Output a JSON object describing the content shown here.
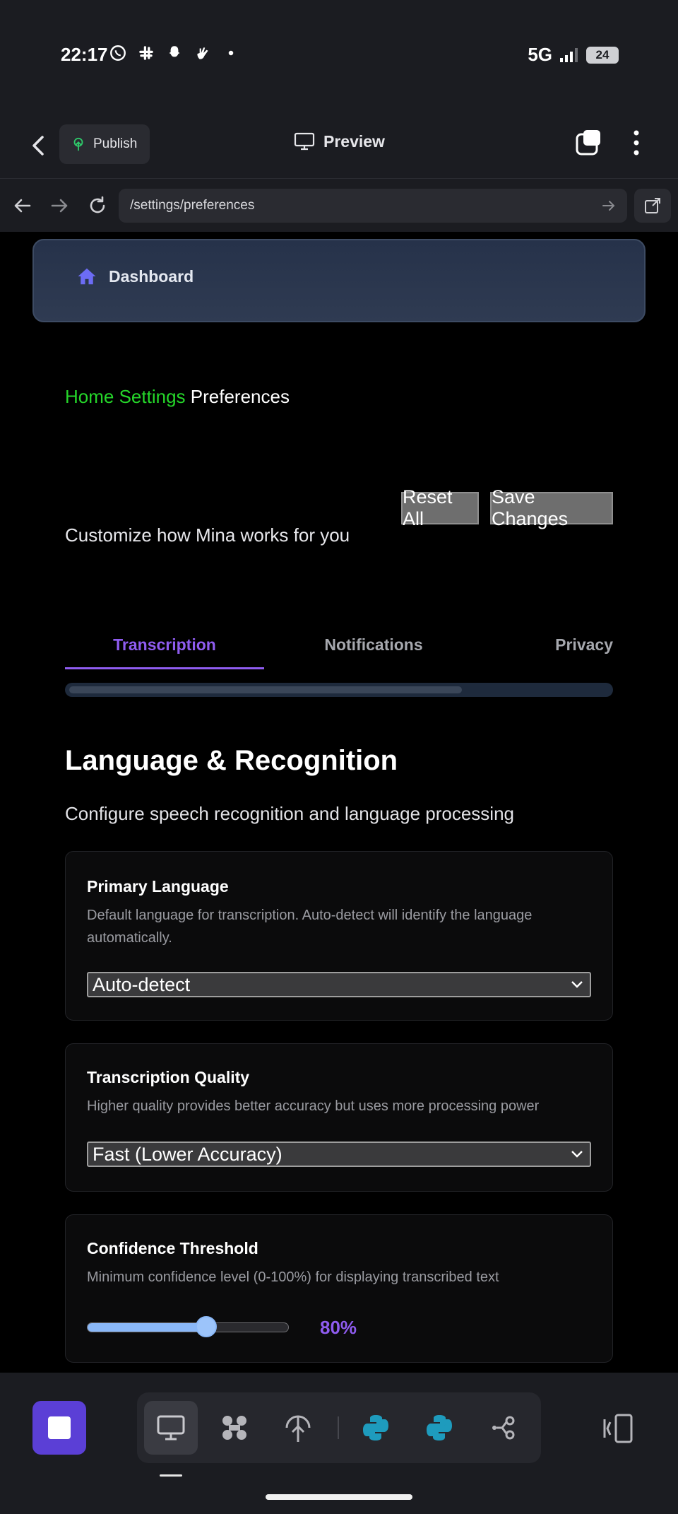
{
  "status": {
    "time": "22:17",
    "network": "5G",
    "battery": "24"
  },
  "appbar": {
    "publish_label": "Publish",
    "preview_label": "Preview"
  },
  "browser": {
    "url": "/settings/preferences"
  },
  "nav": {
    "dashboard_label": "Dashboard"
  },
  "breadcrumb": {
    "home": "Home",
    "settings": "Settings",
    "current": "Preferences"
  },
  "header": {
    "subtitle": "Customize how Mina works for you",
    "reset_label": "Reset All",
    "save_label": "Save Changes"
  },
  "tabs": [
    {
      "label": "Transcription",
      "active": true
    },
    {
      "label": "Notifications",
      "active": false
    },
    {
      "label": "Privacy",
      "active": false
    }
  ],
  "section": {
    "title": "Language & Recognition",
    "subtitle": "Configure speech recognition and language processing"
  },
  "settings": {
    "primary_language": {
      "title": "Primary Language",
      "description": "Default language for transcription. Auto-detect will identify the language automatically.",
      "value": "Auto-detect"
    },
    "quality": {
      "title": "Transcription Quality",
      "description": "Higher quality provides better accuracy but uses more processing power",
      "value": "Fast (Lower Accuracy)"
    },
    "confidence": {
      "title": "Confidence Threshold",
      "description": "Minimum confidence level (0-100%) for displaying transcribed text",
      "value_label": "80%",
      "level": 0.59
    }
  },
  "colors": {
    "accent": "#8f5cf0",
    "link": "#25d62a",
    "stop_button": "#5b3fd6"
  }
}
